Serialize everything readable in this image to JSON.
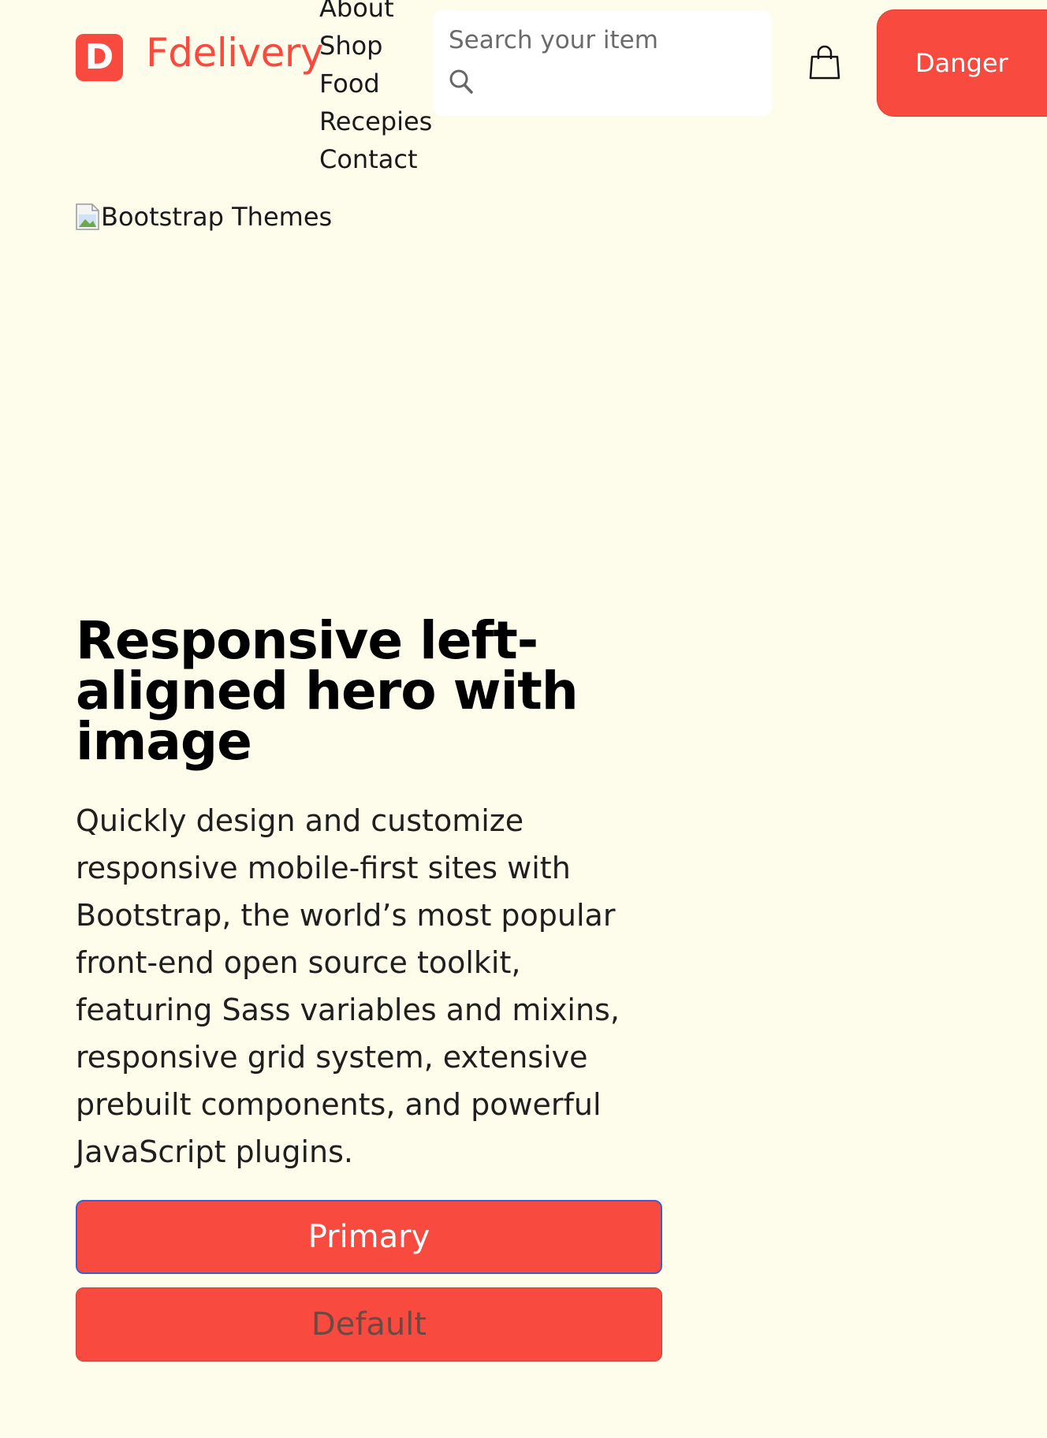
{
  "brand": {
    "logo_letter": "D",
    "name": "Fdelivery"
  },
  "nav": {
    "items": [
      "About",
      "Shop",
      "Food",
      "Recepies",
      "Contact"
    ]
  },
  "search": {
    "placeholder": "Search your item",
    "icon": "search-icon"
  },
  "cart": {
    "icon": "shopping-bag-icon"
  },
  "header": {
    "danger_label": "Danger"
  },
  "hero": {
    "image_alt": "Bootstrap Themes",
    "title": "Responsive left-aligned hero with image",
    "lead": "Quickly design and customize responsive mobile-first sites with Bootstrap, the world’s most popular front-end open source toolkit, featuring Sass variables and mixins, responsive grid system, extensive prebuilt components, and powerful JavaScript plugins.",
    "primary_label": "Primary",
    "default_label": "Default"
  },
  "colors": {
    "accent": "#f84a3e",
    "background": "#fefdeb",
    "primary_border": "#3f5fd0"
  }
}
